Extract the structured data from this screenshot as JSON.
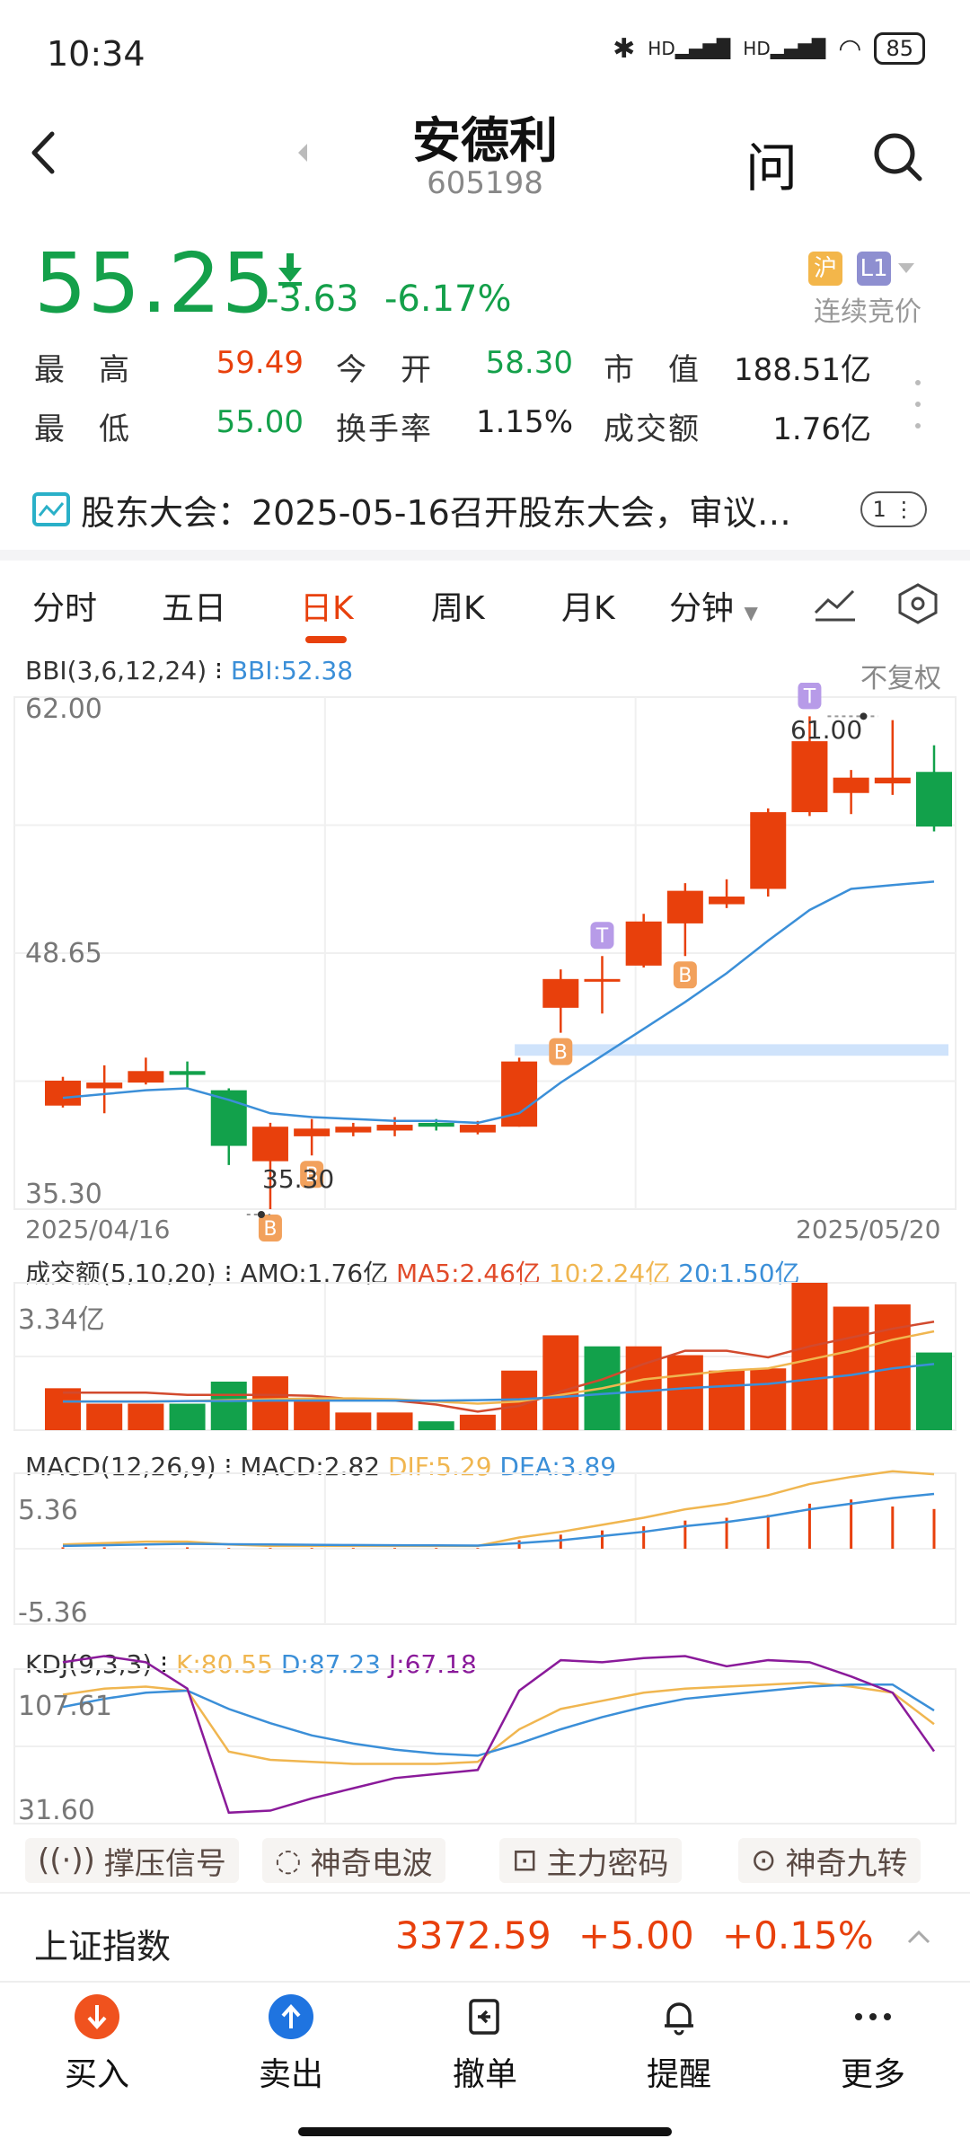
{
  "status_bar": {
    "time": "10:34",
    "network1": "HD",
    "network2": "HD",
    "battery": "85"
  },
  "header": {
    "title": "安德利",
    "code": "605198",
    "ask_label": "问"
  },
  "quote": {
    "price": "55.25",
    "change": "-3.63",
    "change_pct": "-6.17%",
    "exchange_tag": "沪",
    "level_tag": "L1",
    "session": "连续竞价",
    "stats": [
      {
        "label": "最　高",
        "value": "59.49",
        "color": "red"
      },
      {
        "label": "今　开",
        "value": "58.30",
        "color": "green"
      },
      {
        "label": "市　值",
        "value": "188.51亿",
        "color": "black"
      },
      {
        "label": "最　低",
        "value": "55.00",
        "color": "green"
      },
      {
        "label": "换手率",
        "value": "1.15%",
        "color": "black"
      },
      {
        "label": "成交额",
        "value": "1.76亿",
        "color": "black"
      }
    ]
  },
  "notice": {
    "text": "股东大会：2025-05-16召开股东大会，审议…",
    "badge": "1"
  },
  "tabs": [
    "分时",
    "五日",
    "日K",
    "周K",
    "月K",
    "分钟"
  ],
  "active_tab": "日K",
  "chart": {
    "main_indicator": "BBI(3,6,12,24)",
    "main_value": "BBI:52.38",
    "adjust": "不复权",
    "y_top": "62.00",
    "y_mid": "48.65",
    "y_bottom": "35.30",
    "high_marker": "61.00",
    "low_marker": "35.30",
    "date_start": "2025/04/16",
    "date_end": "2025/05/20",
    "vol_indicator": "成交额(5,10,20)",
    "vol_amo": "AMO:1.76亿",
    "vol_ma5": "MA5:2.46亿",
    "vol_ma10": "10:2.24亿",
    "vol_ma20": "20:1.50亿",
    "vol_top": "3.34亿",
    "macd_indicator": "MACD(12,26,9)",
    "macd_value": "MACD:2.82",
    "dif_value": "DIF:5.29",
    "dea_value": "DEA:3.89",
    "macd_top": "5.36",
    "macd_bottom": "-5.36",
    "kdj_indicator": "KDJ(9,3,3)",
    "k_value": "K:80.55",
    "d_value": "D:87.23",
    "j_value": "J:67.18",
    "kdj_top": "107.61",
    "kdj_bottom": "31.60"
  },
  "features": [
    "撑压信号",
    "神奇电波",
    "主力密码",
    "神奇九转"
  ],
  "index": {
    "name": "上证指数",
    "value": "3372.59",
    "change": "+5.00",
    "pct": "+0.15%"
  },
  "actions": [
    "买入",
    "卖出",
    "撤单",
    "提醒",
    "更多"
  ],
  "candles": [
    {
      "o": 42.0,
      "c": 40.7,
      "h": 42.2,
      "l": 40.6,
      "up": true
    },
    {
      "o": 41.6,
      "c": 41.9,
      "h": 42.8,
      "l": 40.3,
      "up": true
    },
    {
      "o": 41.9,
      "c": 42.5,
      "h": 43.2,
      "l": 41.8,
      "up": true
    },
    {
      "o": 42.5,
      "c": 42.3,
      "h": 43.0,
      "l": 41.6,
      "up": false
    },
    {
      "o": 41.5,
      "c": 38.6,
      "h": 41.6,
      "l": 37.6,
      "up": false
    },
    {
      "o": 39.6,
      "c": 37.8,
      "h": 39.8,
      "l": 35.3,
      "up": true
    },
    {
      "o": 39.5,
      "c": 39.1,
      "h": 40.0,
      "l": 38.1,
      "up": true
    },
    {
      "o": 39.3,
      "c": 39.6,
      "h": 39.8,
      "l": 39.1,
      "up": true
    },
    {
      "o": 39.4,
      "c": 39.7,
      "h": 40.1,
      "l": 39.1,
      "up": true
    },
    {
      "o": 39.8,
      "c": 39.6,
      "h": 40.0,
      "l": 39.4,
      "up": false
    },
    {
      "o": 39.3,
      "c": 39.7,
      "h": 39.9,
      "l": 39.2,
      "up": true
    },
    {
      "o": 39.6,
      "c": 43.0,
      "h": 43.2,
      "l": 39.6,
      "up": true
    },
    {
      "o": 45.8,
      "c": 47.3,
      "h": 47.8,
      "l": 44.5,
      "up": true
    },
    {
      "o": 47.2,
      "c": 47.3,
      "h": 48.5,
      "l": 45.5,
      "up": true
    },
    {
      "o": 48.0,
      "c": 50.3,
      "h": 50.7,
      "l": 47.9,
      "up": true
    },
    {
      "o": 50.2,
      "c": 51.9,
      "h": 52.3,
      "l": 48.5,
      "up": true
    },
    {
      "o": 51.2,
      "c": 51.6,
      "h": 52.5,
      "l": 51.0,
      "up": true
    },
    {
      "o": 52.0,
      "c": 56.0,
      "h": 56.2,
      "l": 51.6,
      "up": true
    },
    {
      "o": 56.0,
      "c": 59.7,
      "h": 61.0,
      "l": 55.8,
      "up": true
    },
    {
      "o": 57.8,
      "c": 57.0,
      "h": 58.2,
      "l": 55.9,
      "up": true
    },
    {
      "o": 57.8,
      "c": 57.5,
      "h": 60.8,
      "l": 56.9,
      "up": true
    },
    {
      "o": 58.1,
      "c": 55.25,
      "h": 59.49,
      "l": 55.0,
      "up": false
    }
  ],
  "bbi": [
    41.1,
    41.3,
    41.5,
    41.6,
    41.0,
    40.3,
    40.1,
    40.0,
    39.9,
    39.9,
    39.8,
    40.3,
    41.9,
    43.3,
    44.7,
    46.1,
    47.6,
    49.3,
    50.9,
    52.0,
    52.2,
    52.38
  ],
  "volumes": [
    {
      "v": 0.95,
      "up": true
    },
    {
      "v": 0.6,
      "up": true
    },
    {
      "v": 0.6,
      "up": true
    },
    {
      "v": 0.6,
      "up": false
    },
    {
      "v": 1.1,
      "up": false
    },
    {
      "v": 1.22,
      "up": true
    },
    {
      "v": 0.7,
      "up": true
    },
    {
      "v": 0.4,
      "up": true
    },
    {
      "v": 0.4,
      "up": true
    },
    {
      "v": 0.2,
      "up": false
    },
    {
      "v": 0.35,
      "up": true
    },
    {
      "v": 1.35,
      "up": true
    },
    {
      "v": 2.15,
      "up": true
    },
    {
      "v": 1.9,
      "up": false
    },
    {
      "v": 1.9,
      "up": true
    },
    {
      "v": 1.7,
      "up": true
    },
    {
      "v": 1.35,
      "up": true
    },
    {
      "v": 1.4,
      "up": true
    },
    {
      "v": 3.34,
      "up": true
    },
    {
      "v": 2.8,
      "up": true
    },
    {
      "v": 2.85,
      "up": true
    },
    {
      "v": 1.76,
      "up": false
    }
  ],
  "vol_ma5": [
    0.85,
    0.85,
    0.85,
    0.8,
    0.8,
    0.8,
    0.78,
    0.7,
    0.67,
    0.58,
    0.42,
    0.55,
    0.88,
    1.15,
    1.5,
    1.8,
    1.8,
    1.65,
    1.9,
    2.1,
    2.3,
    2.46
  ],
  "vol_ma10": [
    0.65,
    0.65,
    0.65,
    0.66,
    0.68,
    0.7,
    0.72,
    0.72,
    0.7,
    0.65,
    0.6,
    0.65,
    0.8,
    0.95,
    1.15,
    1.25,
    1.35,
    1.4,
    1.6,
    1.8,
    2.05,
    2.24
  ],
  "vol_ma20": [
    0.65,
    0.65,
    0.65,
    0.66,
    0.66,
    0.67,
    0.67,
    0.67,
    0.67,
    0.67,
    0.68,
    0.7,
    0.75,
    0.82,
    0.88,
    0.95,
    1.0,
    1.05,
    1.15,
    1.25,
    1.4,
    1.5
  ],
  "macd_hist": [
    0.1,
    0.1,
    0.1,
    0.1,
    0.05,
    0.05,
    0.05,
    0.05,
    0.05,
    0.05,
    0.05,
    0.6,
    1.0,
    1.3,
    1.6,
    2.0,
    2.2,
    2.4,
    3.2,
    3.5,
    3.0,
    2.82
  ],
  "macd_dif": [
    0.3,
    0.4,
    0.5,
    0.5,
    0.3,
    0.2,
    0.2,
    0.2,
    0.2,
    0.2,
    0.2,
    0.8,
    1.2,
    1.7,
    2.2,
    2.8,
    3.2,
    3.8,
    4.6,
    5.1,
    5.5,
    5.29
  ],
  "macd_dea": [
    0.2,
    0.25,
    0.3,
    0.35,
    0.32,
    0.3,
    0.28,
    0.26,
    0.25,
    0.24,
    0.22,
    0.4,
    0.6,
    0.9,
    1.2,
    1.6,
    1.9,
    2.3,
    2.8,
    3.2,
    3.6,
    3.89
  ],
  "kdj_k": [
    95,
    98,
    99,
    97,
    67,
    63,
    62,
    61,
    61,
    61,
    62,
    78,
    88,
    92,
    96,
    98,
    99,
    100,
    101,
    99,
    96,
    80.55
  ],
  "kdj_d": [
    89,
    93,
    96,
    97,
    88,
    81,
    75,
    71,
    68,
    66,
    65,
    71,
    78,
    84,
    89,
    93,
    95,
    97,
    99,
    100,
    100,
    87.23
  ],
  "kdj_j": [
    111,
    114,
    111,
    98,
    37,
    38,
    44,
    49,
    54,
    56,
    58,
    97,
    112,
    111,
    113,
    114,
    109,
    112,
    111,
    104,
    96,
    67.18
  ]
}
